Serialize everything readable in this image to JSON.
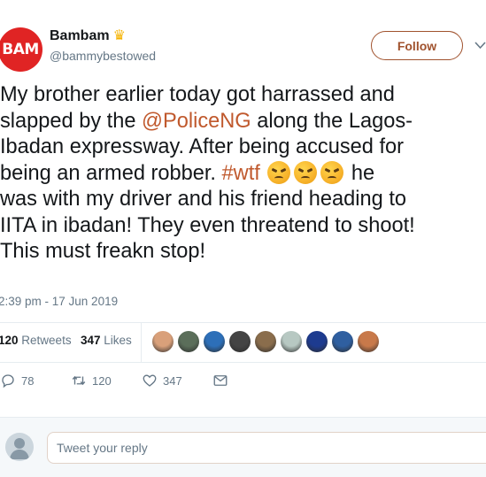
{
  "user": {
    "avatar_text": "BAM",
    "display_name": "Bambam",
    "badge_icon": "crown-icon",
    "handle": "@bammybestowed",
    "follow_label": "Follow"
  },
  "tweet": {
    "line1": "My brother earlier today got harrassed and",
    "line2_pre": "slapped by the ",
    "mention": "@PoliceNG",
    "line2_post": " along the Lagos-",
    "line3": "Ibadan expressway. After being accused for",
    "line4_pre": "being an armed robber. ",
    "hashtag": "#wtf",
    "line4_post": " he",
    "line5": "was with my driver and his friend heading to",
    "line6": "IITA in ibadan! They even threatend to shoot!",
    "line7": "This must freakn stop!",
    "emoji": [
      "angry-face-icon",
      "angry-face-icon",
      "angry-face-icon"
    ],
    "timestamp": "2:39 pm - 17 Jun 2019"
  },
  "stats": {
    "retweets_count": "120",
    "retweets_label": "Retweets",
    "likes_count": "347",
    "likes_label": "Likes",
    "liker_colors": [
      "#d9a07a",
      "#5b6e5a",
      "#2d6fb8",
      "#444444",
      "#8a6d4c",
      "#b7c8c2",
      "#1d3b8f",
      "#2f5fa0",
      "#c8794a"
    ]
  },
  "actions": {
    "reply_count": "78",
    "retweet_count": "120",
    "like_count": "347"
  },
  "reply": {
    "placeholder": "Tweet your reply"
  },
  "colors": {
    "accent": "#c0592d",
    "follow_border": "#a0522d",
    "muted": "#657786"
  }
}
